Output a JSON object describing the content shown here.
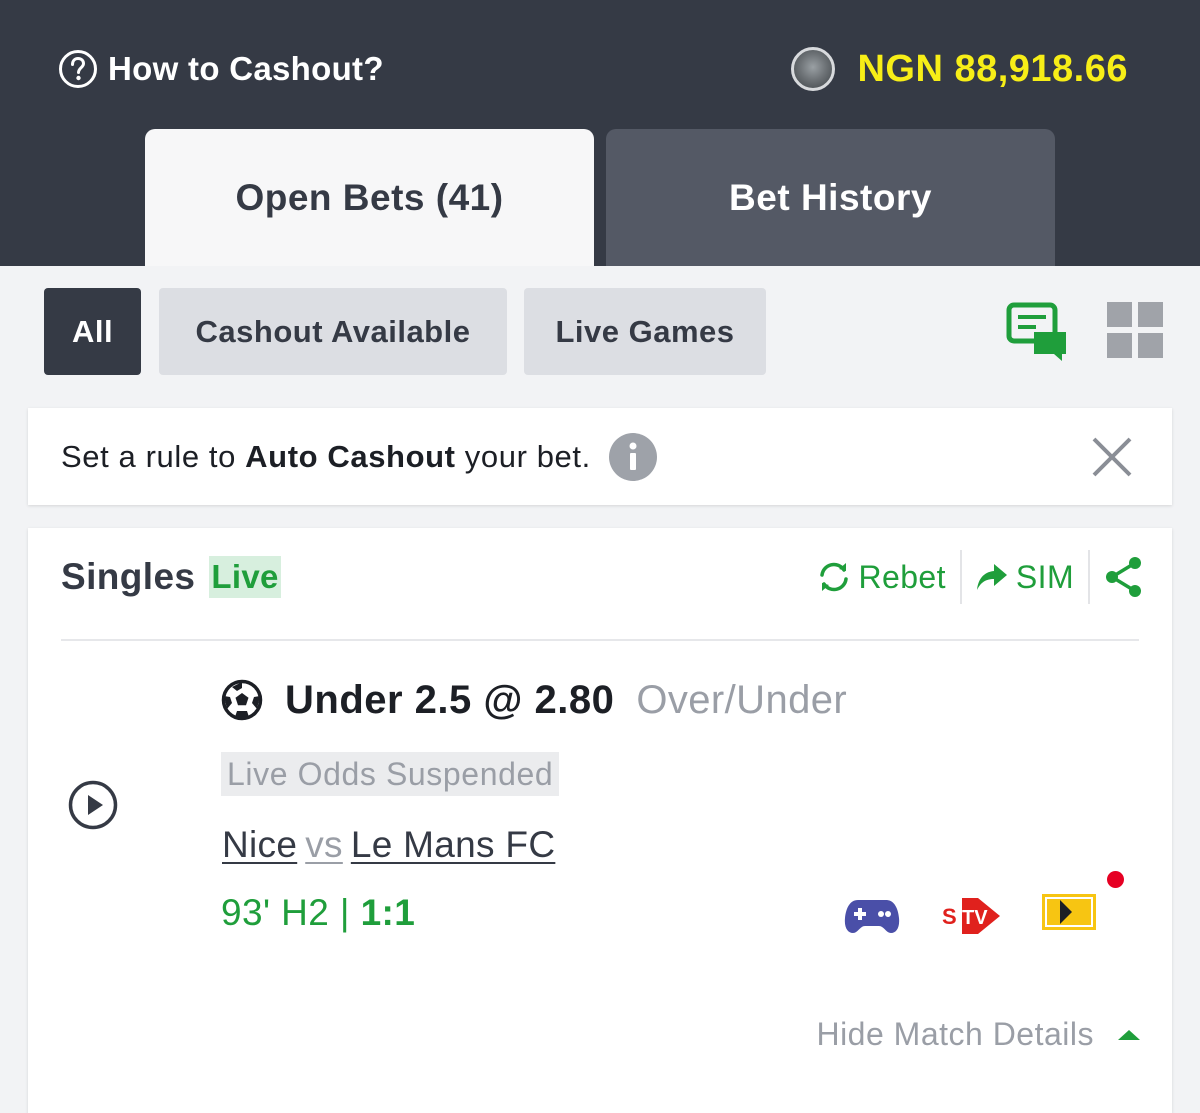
{
  "header": {
    "help_label": "How to Cashout?",
    "balance": "NGN 88,918.66",
    "balance_color": "#f7ee17",
    "background": "#353a45"
  },
  "tabs": [
    {
      "label": "Open Bets (41)",
      "active": true
    },
    {
      "label": "Bet History",
      "active": false
    }
  ],
  "filters": {
    "items": [
      {
        "label": "All",
        "active": true
      },
      {
        "label": "Cashout Available",
        "active": false
      },
      {
        "label": "Live Games",
        "active": false
      }
    ],
    "icons": [
      "chat-bubble-icon",
      "grid-view-icon"
    ]
  },
  "notice": {
    "prefix": "Set a rule to ",
    "bold": "Auto Cashout",
    "suffix": " your bet."
  },
  "bet": {
    "type": "Singles",
    "live_tag": "Live",
    "actions": {
      "rebet": "Rebet",
      "sim": "SIM"
    },
    "selection": "Under 2.5 @ 2.80",
    "market": "Over/Under",
    "status": "Live Odds Suspended",
    "home": "Nice",
    "vs": "vs",
    "away": "Le Mans FC",
    "time": "93' H2 | ",
    "score": "1:1",
    "hide_details": "Hide Match Details",
    "accent": "#1f9e3b"
  }
}
